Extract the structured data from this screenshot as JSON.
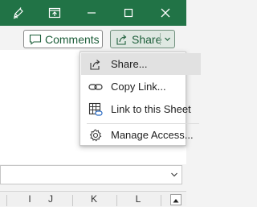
{
  "titlebar": {
    "buttons": [
      {
        "name": "pen-icon"
      },
      {
        "name": "ribbon-display-options-icon"
      },
      {
        "name": "minimize-icon"
      },
      {
        "name": "restore-icon"
      },
      {
        "name": "close-icon"
      }
    ],
    "color": "#217346"
  },
  "ribbon": {
    "comments_label": "Comments",
    "share_label": "Share"
  },
  "share_menu": {
    "items": [
      {
        "label": "Share...",
        "icon": "share-icon",
        "highlighted": true
      },
      {
        "label": "Copy Link...",
        "icon": "link-icon",
        "highlighted": false
      },
      {
        "label": "Link to this Sheet",
        "icon": "sheet-link-icon",
        "highlighted": false
      },
      {
        "label": "Manage Access...",
        "icon": "gear-icon",
        "highlighted": false
      }
    ]
  },
  "grid": {
    "columns": [
      "I",
      "J",
      "K",
      "L"
    ]
  }
}
